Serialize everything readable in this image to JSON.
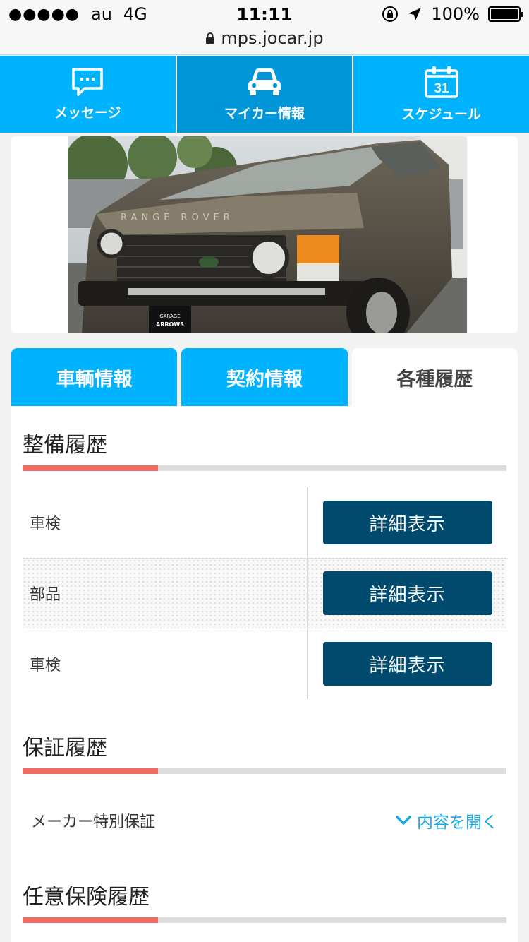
{
  "status_bar": {
    "signal_dots": "●●●●●",
    "carrier": "au",
    "network": "4G",
    "time": "11:11",
    "battery": "100%",
    "url": "mps.jocar.jp"
  },
  "nav": [
    {
      "label": "メッセージ",
      "icon": "chat-bubble-icon"
    },
    {
      "label": "マイカー情報",
      "icon": "car-icon",
      "active": true
    },
    {
      "label": "スケジュール",
      "icon": "calendar-icon",
      "calendar_day": "31"
    }
  ],
  "car_photo": {
    "hood_text": "RANGE ROVER",
    "plate_top": "GARAGE",
    "plate_bottom": "ARROWS"
  },
  "tabs": [
    {
      "label": "車輌情報"
    },
    {
      "label": "契約情報"
    },
    {
      "label": "各種履歴",
      "active": true
    }
  ],
  "maintenance": {
    "title": "整備履歴",
    "rows": [
      {
        "name": "車検",
        "button": "詳細表示"
      },
      {
        "name": "部品",
        "button": "詳細表示"
      },
      {
        "name": "車検",
        "button": "詳細表示"
      }
    ]
  },
  "warranty": {
    "title": "保証履歴",
    "item": "メーカー特別保証",
    "open_label": "内容を開く"
  },
  "insurance": {
    "title": "任意保険履歴"
  },
  "colors": {
    "primary": "#00b3ff",
    "nav_active": "#0096d8",
    "button": "#004a6e",
    "accent": "#f16a61",
    "link": "#1aa9e5"
  }
}
